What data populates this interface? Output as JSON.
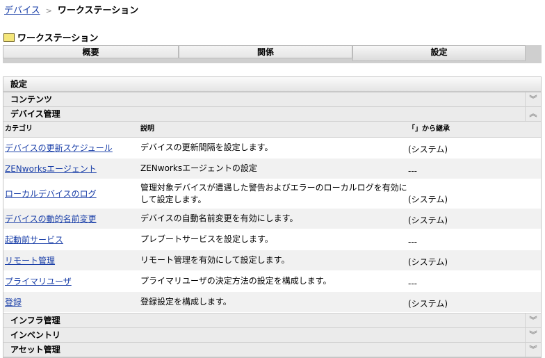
{
  "breadcrumb": {
    "parent": "デバイス",
    "current": "ワークステーション"
  },
  "title": "ワークステーション",
  "tabs": [
    "概要",
    "関係",
    "設定"
  ],
  "panel": {
    "header": "設定",
    "sections_top": [
      {
        "label": "コンテンツ",
        "icon": "expand"
      },
      {
        "label": "デバイス管理",
        "icon": "collapse"
      }
    ],
    "columns": [
      "カテゴリ",
      "説明",
      "「」から継承"
    ],
    "rows": [
      {
        "category": "デバイスの更新スケジュール",
        "description": "デバイスの更新間隔を設定します。",
        "inherit": "(システム)"
      },
      {
        "category": "ZENworksエージェント",
        "description": "ZENworksエージェントの設定",
        "inherit": "---"
      },
      {
        "category": "ローカルデバイスのログ",
        "description": "管理対象デバイスが遭遇した警告およびエラーのローカルログを有効にして設定します。",
        "inherit": "(システム)"
      },
      {
        "category": "デバイスの動的名前変更",
        "description": "デバイスの自動名前変更を有効にします。",
        "inherit": "(システム)"
      },
      {
        "category": "起動前サービス",
        "description": "プレブートサービスを設定します。",
        "inherit": "---"
      },
      {
        "category": "リモート管理",
        "description": "リモート管理を有効にして設定します。",
        "inherit": "(システム)"
      },
      {
        "category": "プライマリユーザ",
        "description": "プライマリユーザの決定方法の設定を構成します。",
        "inherit": "---"
      },
      {
        "category": "登録",
        "description": "登録設定を構成します。",
        "inherit": "(システム)"
      }
    ],
    "sections_bottom": [
      {
        "label": "インフラ管理"
      },
      {
        "label": "インベントリ"
      },
      {
        "label": "アセット管理"
      }
    ]
  }
}
